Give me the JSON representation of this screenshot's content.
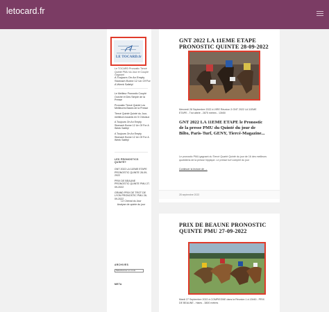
{
  "header": {
    "site_title": "letocard.fr"
  },
  "sidebar": {
    "logo_text": "LE TOCARD.fr",
    "tagline": "Le TOCARD Pronostic Tiercé Quinté PMU du Jour et Couplé Gagnant",
    "intro_link": "A Toujours On An Empty Stomach Borne 12 Un Of For A Week Safely!",
    "recent_links": [
      "Le Meilleur Pronostic Couplé Ourché et Des Simple de la Presse",
      "Pronostic Tiercé Quinté Les Meilleures Bases de la Presse",
      "Tiercé Quinté Quinté du Jour, meilleurs tocards en 5 Chevaux",
      "A Toujours On An Empty Stomach Borne 12 Un Of For A Week Safely!",
      "A Toujours On An Empty Stomach Borne 12 Un Of For A Week Safely!"
    ],
    "pronostics_heading": "LES PRONOSTICS QUINTÉ+",
    "pronostics_links": [
      "GNT 2022 LA 11EME ETAPE PRONOSTIC QUINTE 28-09-2022",
      "PRIX DE BEAUNE PRONOSTIC QUINTE PMU 27-09-2022",
      "GRAND PRIX DE TROT DE LYON PRONOSTIC PMU 26-09-2022"
    ],
    "bottom_links": [
      "Le Cheval du Jour",
      "Analyse de quinte du jour"
    ],
    "archives_heading": "ARCHIVES",
    "archives_select_value": "Sélectionner un mois",
    "meta_link": "META"
  },
  "posts": [
    {
      "title": "GNT 2022 LA 11EME ETAPE PRONOSTIC QUINTE 28-09-2022",
      "meta": "Mercredi 28 Septembre 2022 à VIRE Réunion 3 GNT 2022 LA 11EME ETAPE - Trot attelé - 2875 mètres - 13h50",
      "subtitle": "GNT 2022 LA 11EME ETAPE le Pronostic de la presse PMU du Quinté du jour de Bilto, Paris-Turf, GENY, Tiercé-Magazine...",
      "body": "Le pronostic PMU gagnant du Tiercé Quarté Quinté du jour de 16 des meilleurs quotidiens de la presse hippique. Le presse turf complet du jour",
      "read_more": "Continuer la lecture de →",
      "date": "28 septembre 2022"
    },
    {
      "title": "PRIX DE BEAUNE PRONOSTIC QUINTE PMU 27-09-2022",
      "meta": "Mardi 27 Septembre 2022 à COMPIEGNE dans la Réunion 1 à 13h50 - PRIX DE BEAUNE - Haies - 3800 mètres"
    }
  ],
  "colors": {
    "header_bg": "#7b3c64",
    "highlight_border": "#e03a2a",
    "page_bg": "#f1f1f1"
  }
}
